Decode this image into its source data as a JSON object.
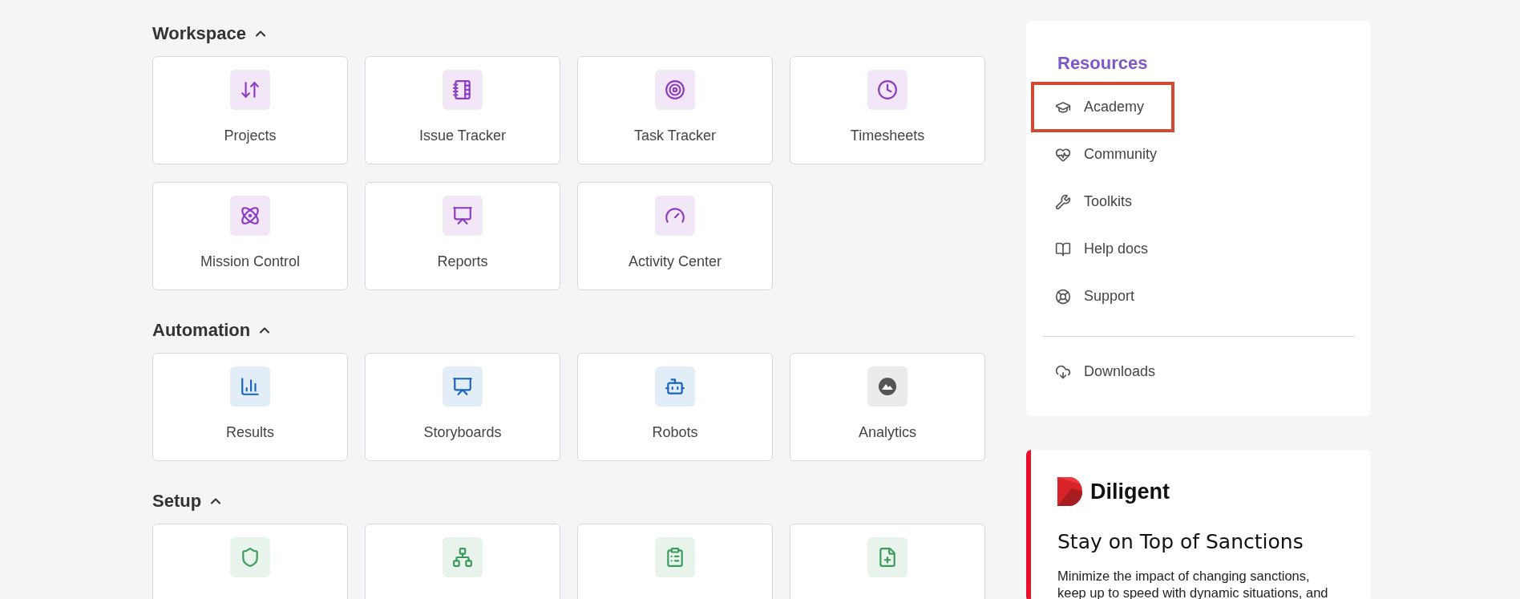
{
  "sections": [
    {
      "title": "Workspace",
      "expanded": true,
      "cards": [
        {
          "label": "Projects",
          "color": "#8e3bbf"
        },
        {
          "label": "Issue Tracker",
          "color": "#8e3bbf"
        },
        {
          "label": "Task Tracker",
          "color": "#8e3bbf"
        },
        {
          "label": "Timesheets",
          "color": "#8e3bbf"
        },
        {
          "label": "Mission Control",
          "color": "#8e3bbf"
        },
        {
          "label": "Reports",
          "color": "#8e3bbf"
        },
        {
          "label": "Activity Center",
          "color": "#8e3bbf"
        }
      ]
    },
    {
      "title": "Automation",
      "expanded": true,
      "cards": [
        {
          "label": "Results",
          "color": "#1565c0"
        },
        {
          "label": "Storyboards",
          "color": "#1565c0"
        },
        {
          "label": "Robots",
          "color": "#1565c0"
        },
        {
          "label": "Analytics",
          "color": "#555555"
        }
      ]
    },
    {
      "title": "Setup",
      "expanded": true,
      "cards": [
        {
          "color": "#3a9a5b"
        },
        {
          "color": "#3a9a5b"
        },
        {
          "color": "#3a9a5b"
        },
        {
          "color": "#3a9a5b"
        }
      ]
    }
  ],
  "resources": {
    "title": "Resources",
    "items": [
      {
        "label": "Academy",
        "highlighted": true
      },
      {
        "label": "Community",
        "highlighted": false
      },
      {
        "label": "Toolkits",
        "highlighted": false
      },
      {
        "label": "Help docs",
        "highlighted": false
      },
      {
        "label": "Support",
        "highlighted": false
      }
    ],
    "footer_items": [
      {
        "label": "Downloads"
      }
    ]
  },
  "ad": {
    "brand": "Diligent",
    "title": "Stay on Top of Sanctions",
    "body": "Minimize the impact of changing sanctions,\nkeep up to speed with dynamic situations, and"
  }
}
